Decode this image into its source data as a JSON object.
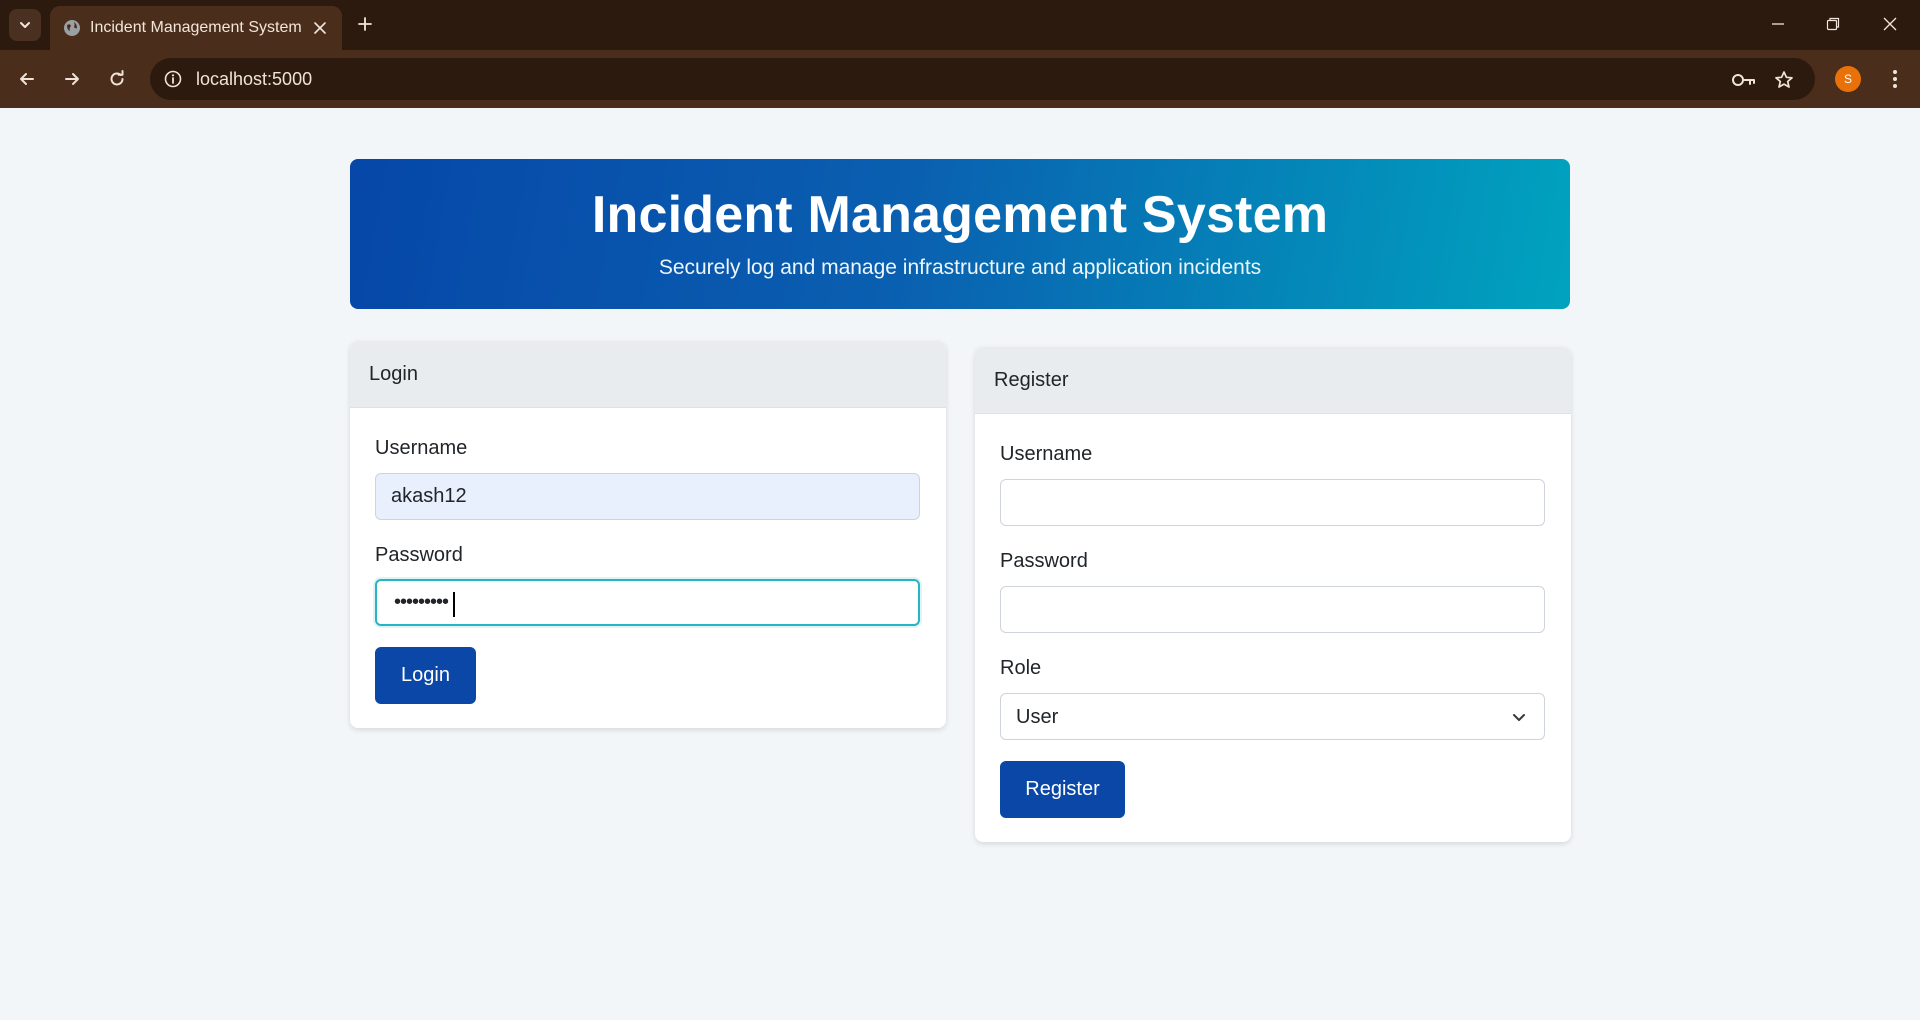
{
  "browser": {
    "tab_title": "Incident Management System",
    "url": "localhost:5000",
    "profile_initial": "S",
    "icons": {
      "tab_search": "chevron-down-icon",
      "tab_close": "close-icon",
      "new_tab": "plus-icon",
      "minimize": "minimize-icon",
      "restore": "restore-icon",
      "close_window": "close-icon",
      "back": "arrow-left-icon",
      "forward": "arrow-right-icon",
      "reload": "reload-icon",
      "site_info": "info-icon",
      "password_key": "key-icon",
      "bookmark": "star-icon",
      "menu": "kebab-menu-icon"
    }
  },
  "hero": {
    "title": "Incident Management System",
    "subtitle": "Securely log and manage infrastructure and application incidents"
  },
  "login": {
    "header": "Login",
    "username_label": "Username",
    "username_value": "akash12",
    "password_label": "Password",
    "password_mask": "•••••••••",
    "submit_label": "Login"
  },
  "register": {
    "header": "Register",
    "username_label": "Username",
    "username_value": "",
    "password_label": "Password",
    "password_value": "",
    "role_label": "Role",
    "role_value": "User",
    "submit_label": "Register"
  },
  "colors": {
    "chrome_dark": "#2d1a0e",
    "chrome_toolbar": "#4a2d1a",
    "page_bg": "#f3f6f9",
    "hero_gradient_start": "#0647a8",
    "hero_gradient_end": "#00a3bf",
    "primary_button": "#0a47a6",
    "focus_ring": "#26b5c4",
    "avatar": "#e8710a"
  }
}
